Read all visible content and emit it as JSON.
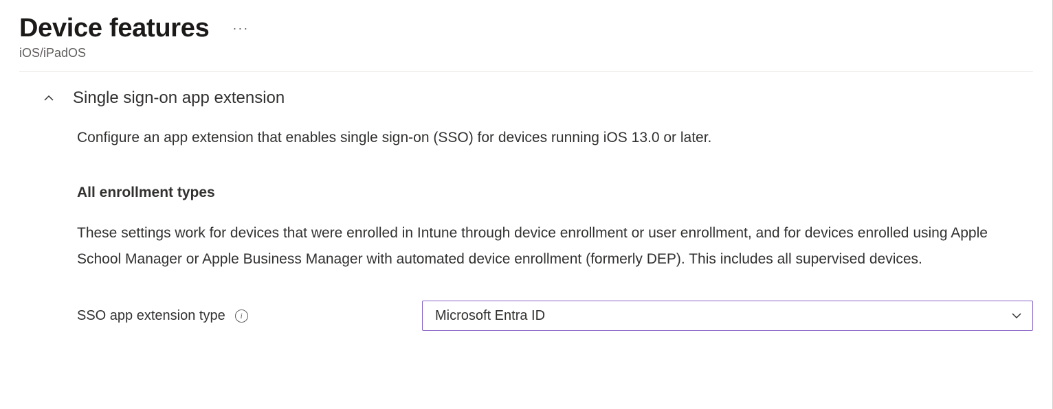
{
  "header": {
    "title": "Device features",
    "subtitle": "iOS/iPadOS"
  },
  "section": {
    "title": "Single sign-on app extension",
    "description": "Configure an app extension that enables single sign-on (SSO) for devices running iOS 13.0 or later.",
    "subsection": {
      "title": "All enrollment types",
      "description": "These settings work for devices that were enrolled in Intune through device enrollment or user enrollment, and for devices enrolled using Apple School Manager or Apple Business Manager with automated device enrollment (formerly DEP). This includes all supervised devices."
    },
    "form": {
      "label": "SSO app extension type",
      "selectedValue": "Microsoft Entra ID"
    }
  }
}
